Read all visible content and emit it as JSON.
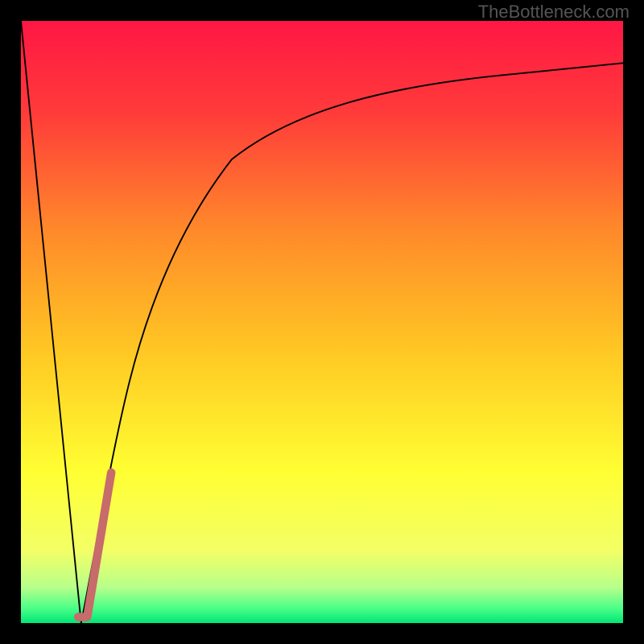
{
  "watermark": "TheBottleneck.com",
  "chart_data": {
    "type": "line",
    "title": "",
    "xlabel": "",
    "ylabel": "",
    "xlim": [
      0,
      100
    ],
    "ylim": [
      0,
      100
    ],
    "grid": false,
    "series": [
      {
        "name": "bottleneck-curve",
        "type": "line",
        "color": "#000000",
        "data": [
          {
            "x": 0,
            "y": 100
          },
          {
            "x": 10,
            "y": 0
          },
          {
            "x": 12,
            "y": 8
          },
          {
            "x": 15,
            "y": 25
          },
          {
            "x": 18,
            "y": 40
          },
          {
            "x": 22,
            "y": 55
          },
          {
            "x": 28,
            "y": 68
          },
          {
            "x": 35,
            "y": 77
          },
          {
            "x": 45,
            "y": 83
          },
          {
            "x": 60,
            "y": 88
          },
          {
            "x": 80,
            "y": 91
          },
          {
            "x": 100,
            "y": 93
          }
        ]
      },
      {
        "name": "highlighted-segment",
        "type": "line",
        "color": "#c76b6b",
        "stroke_width": 10,
        "data": [
          {
            "x": 9.5,
            "y": 1
          },
          {
            "x": 11,
            "y": 1
          },
          {
            "x": 15,
            "y": 25
          }
        ]
      }
    ],
    "background_gradient": {
      "type": "vertical",
      "stops": [
        {
          "offset": 0.0,
          "color": "#ff1744"
        },
        {
          "offset": 0.15,
          "color": "#ff3a3a"
        },
        {
          "offset": 0.35,
          "color": "#ff8a2a"
        },
        {
          "offset": 0.55,
          "color": "#ffc823"
        },
        {
          "offset": 0.75,
          "color": "#ffff33"
        },
        {
          "offset": 0.88,
          "color": "#f3ff66"
        },
        {
          "offset": 0.94,
          "color": "#b8ff8a"
        },
        {
          "offset": 0.975,
          "color": "#4dff88"
        },
        {
          "offset": 1.0,
          "color": "#00e676"
        }
      ]
    }
  }
}
